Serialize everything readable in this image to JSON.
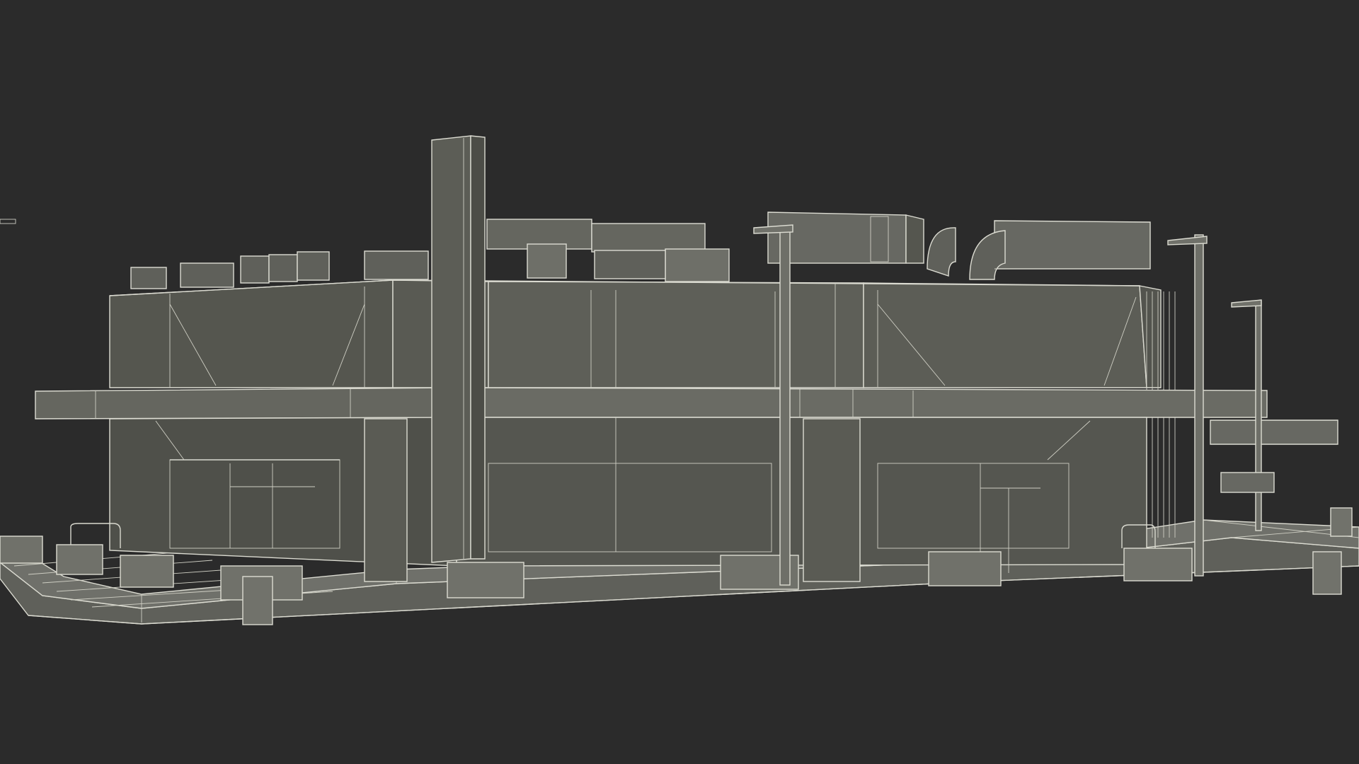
{
  "viewport": {
    "background": "#2b2b2b"
  },
  "scene": {
    "subject": "wireframe-building-model",
    "colors": {
      "surface_dark": "#4d4e49",
      "surface": "#5b5c56",
      "surface_light": "#6a6b64",
      "ground": "#6f706a",
      "wire": "#d9d9cf"
    }
  }
}
